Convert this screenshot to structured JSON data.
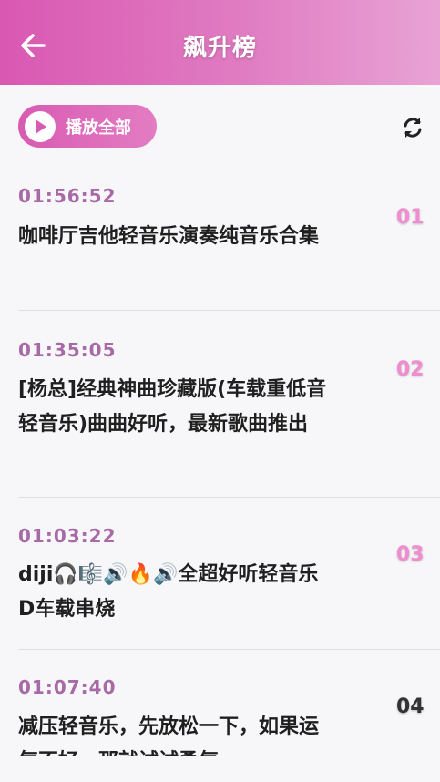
{
  "header": {
    "title": "飙升榜",
    "back_icon": "arrow-left-icon"
  },
  "toolbar": {
    "play_all_label": "播放全部",
    "play_icon": "play-icon",
    "refresh_icon": "refresh-icon"
  },
  "colors": {
    "header_start": "#d958b2",
    "header_end": "#e8a3d5",
    "accent": "#d85bb2",
    "time_text": "#a86aa6",
    "rank_highlight": "#f08ccf"
  },
  "songs": [
    {
      "duration": "01:56:52",
      "title": "咖啡厅吉他轻音乐演奏纯音乐合集",
      "rank": "01"
    },
    {
      "duration": "01:35:05",
      "title": "[杨总]经典神曲珍藏版(车载重低音轻音乐)曲曲好听，最新歌曲推出",
      "rank": "02"
    },
    {
      "duration": "01:03:22",
      "title": "diji🎧🎼🔊🔥🔊全超好听轻音乐D车载串烧",
      "rank": "03"
    },
    {
      "duration": "01:07:40",
      "title": "减压轻音乐，先放松一下，如果运气不好，那就试试勇气",
      "rank": "04"
    }
  ]
}
